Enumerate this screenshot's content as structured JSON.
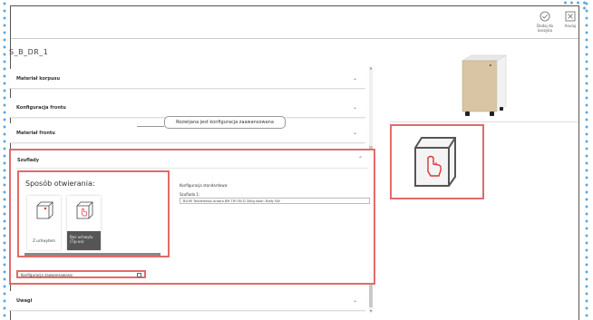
{
  "topbar": {
    "add_to_cart_label": "Dodaj do koszyka",
    "cancel_label": "Anuluj"
  },
  "product": {
    "title": "S_B_DR_1"
  },
  "accordion": {
    "sections": [
      {
        "label": "Materiał korpusu"
      },
      {
        "label": "Konfiguracja frontu"
      },
      {
        "label": "Materiał frontu"
      },
      {
        "label": "Szuflady"
      },
      {
        "label": "Uwagi"
      }
    ]
  },
  "drawers": {
    "opening_label": "Sposób otwierania:",
    "options": [
      {
        "label": "Z uchwytem",
        "selected": false,
        "icon": "cube-dot-icon"
      },
      {
        "label": "Bez uchwytu (Tip-on)",
        "selected": true,
        "icon": "cube-hand-icon"
      }
    ],
    "standard_config_label": "Konfiguracja standardowa:",
    "drawer1_label": "Szuflada 1:",
    "drawer1_value": "BLUM Tandembox Antaro 8M TIP-ON D 30kg kolor: Biały SW",
    "advanced_config_label": "Konfiguracja zaawansowana:",
    "advanced_checked": false
  },
  "callout": {
    "text": "Rozwijana jest konfiguracja zaawansowana"
  },
  "icons": {
    "check_circle": "check-circle-icon",
    "close_box": "close-box-icon",
    "chevron_down": "chevron-down-icon",
    "chevron_up": "chevron-up-icon"
  },
  "colors": {
    "highlight": "#e26a6a",
    "dots": "#5aa6e0",
    "selected_option_bg": "#555555",
    "wood": "#d9c4a3",
    "cabinet_white": "#f2f2f2"
  }
}
